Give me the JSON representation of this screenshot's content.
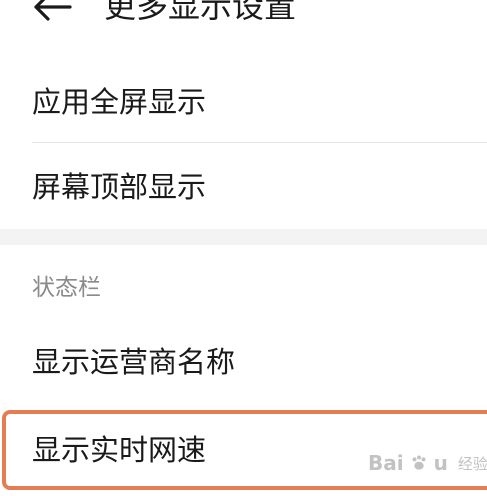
{
  "header": {
    "title": "更多显示设置",
    "back_icon": "arrow-left-icon"
  },
  "settings": {
    "app_fullscreen": "应用全屏显示",
    "screen_top": "屏幕顶部显示"
  },
  "status_bar": {
    "section_title": "状态栏",
    "show_carrier": "显示运营商名称",
    "show_net_speed": "显示实时网速"
  },
  "watermark": {
    "brand": "Bai",
    "brand_suffix": "u",
    "sub": "经验",
    "icon": "baidu-paw-icon"
  },
  "colors": {
    "highlight_border": "#e57d53",
    "section_text": "#8a8a8a",
    "divider": "#e6e6e6"
  }
}
